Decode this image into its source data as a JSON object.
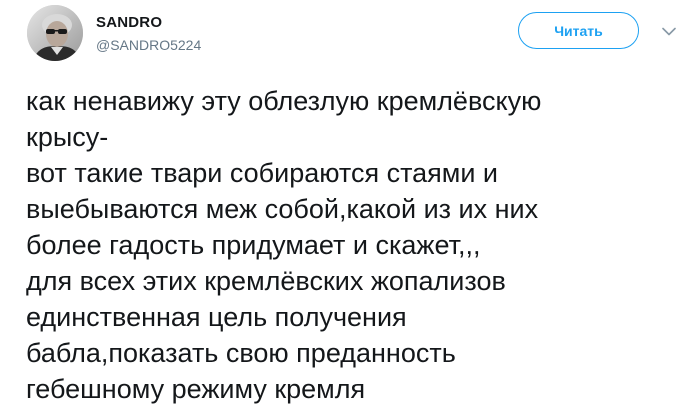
{
  "author": {
    "name": "SANDRO",
    "handle": "@SANDRO5224"
  },
  "follow_button": {
    "label": "Читать"
  },
  "icons": {
    "more": "chevron-down-icon",
    "avatar": "user-avatar"
  },
  "colors": {
    "accent": "#1da1f2",
    "text": "#14171a",
    "secondary_text": "#657786"
  },
  "tweet": {
    "lines": [
      "как ненавижу эту облезлую кремлёвскую",
      "крысу-",
      "вот такие твари собираются стаями и",
      "выебываются меж собой,какой из их них",
      "более гадость придумает и скажет,,,",
      "для всех этих кремлёвских жопализов",
      "единственная цель получения",
      "бабла,показать свою преданность",
      "гебешному режиму кремля"
    ]
  }
}
